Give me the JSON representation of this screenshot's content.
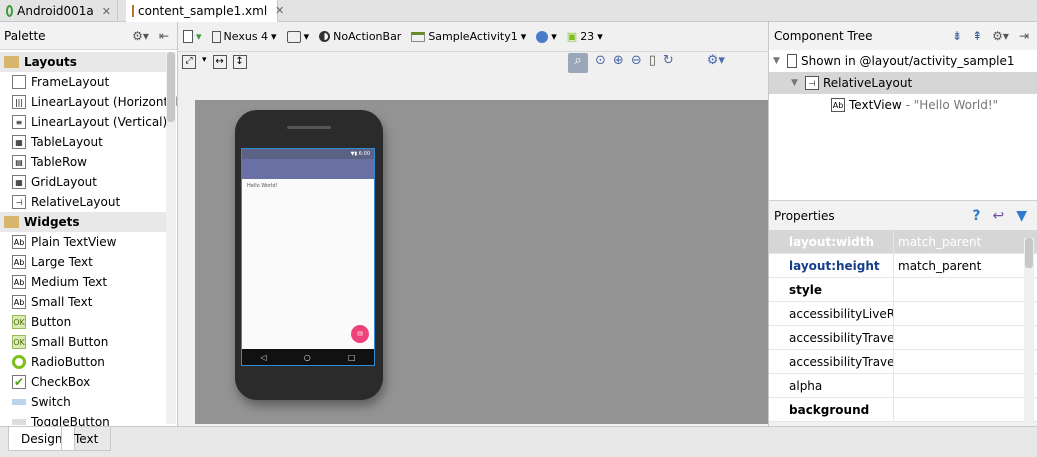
{
  "tabs": [
    {
      "label": "Android001a",
      "icon": "android-project-icon"
    },
    {
      "label": "content_sample1.xml",
      "icon": "xml-file-icon"
    }
  ],
  "palette": {
    "title": "Palette",
    "groups": [
      {
        "label": "Layouts",
        "items": [
          "FrameLayout",
          "LinearLayout (Horizontal)",
          "LinearLayout (Vertical)",
          "TableLayout",
          "TableRow",
          "GridLayout",
          "RelativeLayout"
        ]
      },
      {
        "label": "Widgets",
        "items": [
          "Plain TextView",
          "Large Text",
          "Medium Text",
          "Small Text",
          "Button",
          "Small Button",
          "RadioButton",
          "CheckBox",
          "Switch",
          "ToggleButton"
        ]
      }
    ]
  },
  "toolbar": {
    "device": "Nexus 4",
    "theme": "NoActionBar",
    "activity": "SampleActivity1",
    "api": "23"
  },
  "preview": {
    "status_time": "6:00",
    "hello": "Hello World!"
  },
  "component_tree": {
    "title": "Component Tree",
    "root": "Shown in @layout/activity_sample1",
    "layout": "RelativeLayout",
    "child": "TextView",
    "child_text": "- \"Hello World!\""
  },
  "properties": {
    "title": "Properties",
    "rows": [
      {
        "key": "layout:width",
        "value": "match_parent"
      },
      {
        "key": "layout:height",
        "value": "match_parent"
      },
      {
        "key": "style",
        "value": ""
      },
      {
        "key": "accessibilityLiveReg",
        "value": ""
      },
      {
        "key": "accessibilityTraversa",
        "value": ""
      },
      {
        "key": "accessibilityTraversa",
        "value": ""
      },
      {
        "key": "alpha",
        "value": ""
      },
      {
        "key": "background",
        "value": ""
      }
    ]
  },
  "bottom_tabs": [
    "Design",
    "Text"
  ]
}
